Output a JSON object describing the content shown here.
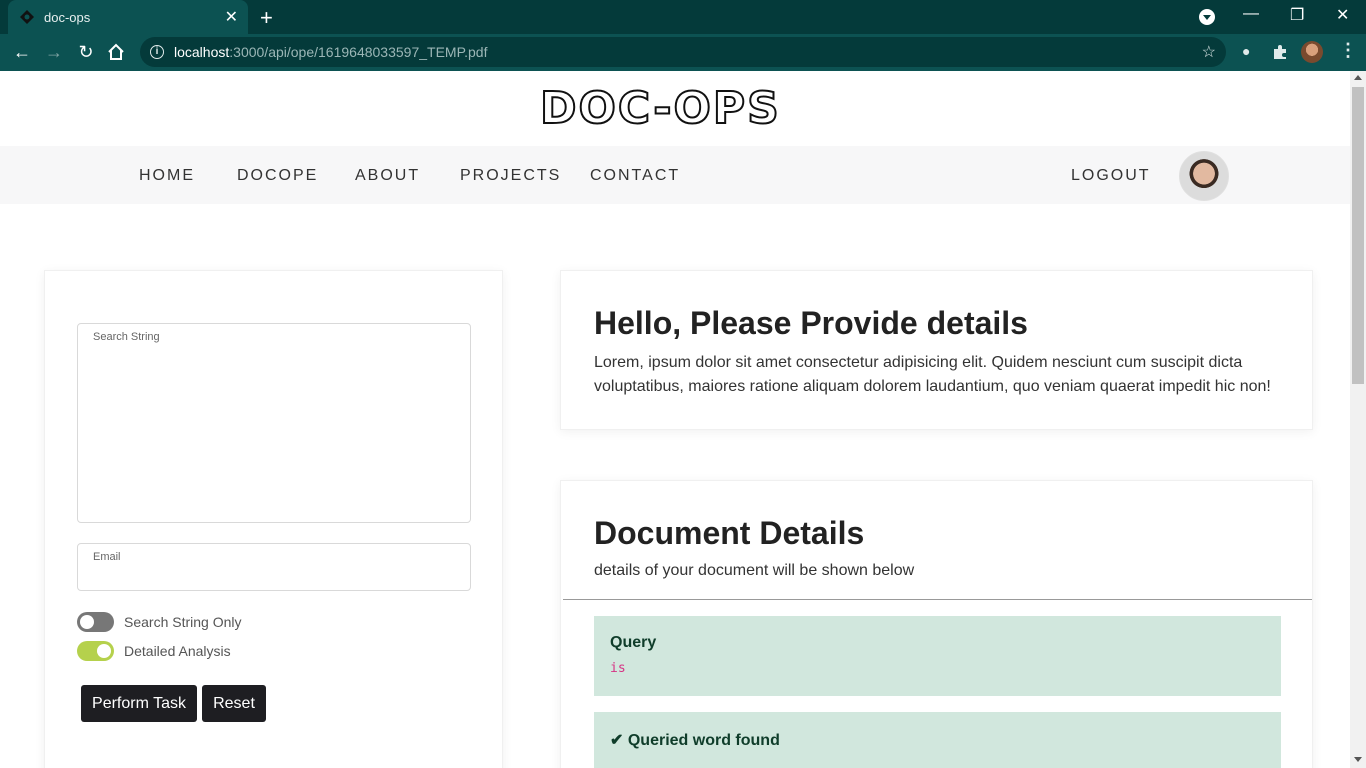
{
  "browser": {
    "tab_title": "doc-ops",
    "url_host": "localhost",
    "url_rest": ":3000/api/ope/1619648033597_TEMP.pdf"
  },
  "site": {
    "logo_text": "DOC-OPS",
    "nav": {
      "home": "HOME",
      "docope": "DOCOPE",
      "about": "ABOUT",
      "projects": "PROJECTS",
      "contact": "CONTACT",
      "logout": "LOGOUT"
    }
  },
  "form": {
    "search_label": "Search String",
    "email_label": "Email",
    "toggle_search_only": "Search String Only",
    "toggle_search_only_on": false,
    "toggle_detailed": "Detailed Analysis",
    "toggle_detailed_on": true,
    "perform_button": "Perform Task",
    "reset_button": "Reset"
  },
  "hello": {
    "title": "Hello, Please Provide details",
    "body": "Lorem, ipsum dolor sit amet consectetur adipisicing elit. Quidem nesciunt cum suscipit dicta voluptatibus, maiores ratione aliquam dolorem laudantium, quo veniam quaerat impedit hic non!"
  },
  "document": {
    "title": "Document Details",
    "subtitle": "details of your document will be shown below",
    "query_heading": "Query",
    "query_value": "is",
    "found_heading": "Queried word found"
  },
  "colors": {
    "toggle_on": "#b5d14c",
    "toggle_off": "#777777",
    "alert_bg": "#d1e7dd",
    "browser_frame": "#0c5252"
  }
}
